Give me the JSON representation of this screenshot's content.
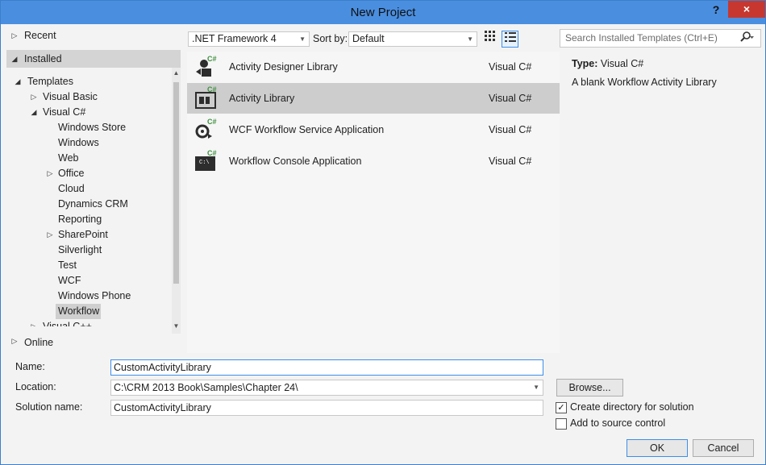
{
  "window": {
    "title": "New Project",
    "help_label": "?",
    "close_label": "×"
  },
  "nav": {
    "recent": "Recent",
    "installed": "Installed",
    "templates": "Templates",
    "visual_basic": "Visual Basic",
    "visual_csharp": "Visual C#",
    "children": [
      "Windows Store",
      "Windows",
      "Web",
      "Office",
      "Cloud",
      "Dynamics CRM",
      "Reporting",
      "SharePoint",
      "Silverlight",
      "Test",
      "WCF",
      "Windows Phone",
      "Workflow"
    ],
    "cut_off_item": "Visual C++",
    "online": "Online"
  },
  "toolbar": {
    "framework": ".NET Framework 4",
    "sort_label": "Sort by:",
    "sort_value": "Default",
    "tiles_icon": "tiles-view-icon",
    "list_icon": "list-view-icon"
  },
  "search": {
    "placeholder": "Search Installed Templates (Ctrl+E)",
    "icon": "search-icon"
  },
  "templates": [
    {
      "name": "Activity Designer Library",
      "lang": "Visual C#",
      "icon": "activity-designer-icon",
      "badge": "C#"
    },
    {
      "name": "Activity Library",
      "lang": "Visual C#",
      "icon": "activity-library-icon",
      "badge": "C#"
    },
    {
      "name": "WCF Workflow Service Application",
      "lang": "Visual C#",
      "icon": "wcf-workflow-icon",
      "badge": "C#"
    },
    {
      "name": "Workflow Console Application",
      "lang": "Visual C#",
      "icon": "console-app-icon",
      "badge": "C#",
      "console_text": "C:\\"
    }
  ],
  "details": {
    "type_label": "Type:",
    "type_value": "Visual C#",
    "description": "A blank Workflow Activity Library"
  },
  "form": {
    "name_label": "Name:",
    "name_value": "CustomActivityLibrary",
    "location_label": "Location:",
    "location_value": "C:\\CRM 2013 Book\\Samples\\Chapter 24\\",
    "solution_label": "Solution name:",
    "solution_value": "CustomActivityLibrary",
    "browse": "Browse...",
    "create_dir": "Create directory for solution",
    "create_dir_checked": true,
    "source_control": "Add to source control",
    "source_control_checked": false,
    "ok": "OK",
    "cancel": "Cancel"
  },
  "colors": {
    "titlebar": "#4a8ee0",
    "close": "#c7372f",
    "focus": "#3c8ee8",
    "csharp_badge": "#3f8f3f"
  }
}
